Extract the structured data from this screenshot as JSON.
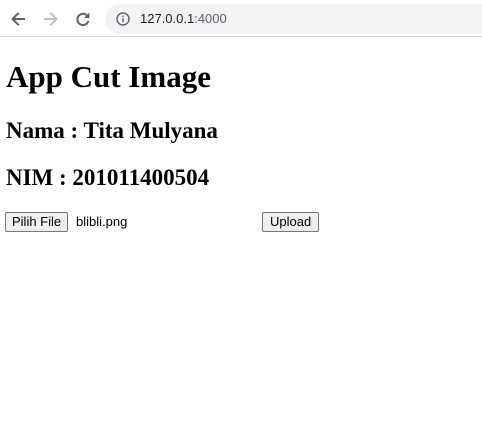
{
  "browser": {
    "url_host": "127.0.0.1",
    "url_port": ":4000",
    "icons": {
      "back": "arrow-left-icon",
      "forward": "arrow-right-icon",
      "reload": "reload-icon",
      "site_info": "info-icon"
    }
  },
  "page": {
    "title": "App Cut Image",
    "nama": "Nama : Tita Mulyana",
    "nim": "NIM : 201011400504"
  },
  "form": {
    "file_button_label": "Pilih File",
    "file_name": "blibli.png",
    "upload_label": "Upload"
  },
  "colors": {
    "omnibox_bg": "#f1f3f4",
    "icon_active": "#5f6368",
    "icon_disabled": "#bdc1c6",
    "button_bg": "#efefef",
    "button_border": "#767676"
  }
}
